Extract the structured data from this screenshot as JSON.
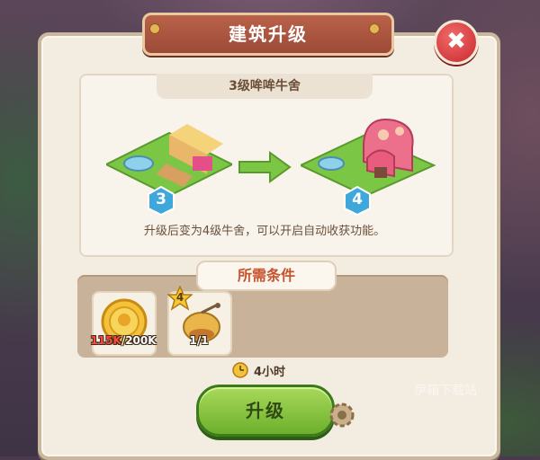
{
  "dialog": {
    "title": "建筑升级",
    "close_icon_glyph": "✖"
  },
  "preview": {
    "building_name": "3级哞哞牛舍",
    "current_level": "3",
    "next_level": "4",
    "description": "升级后变为4级牛舍，可以开启自动收获功能。"
  },
  "requirements": {
    "label": "所需条件",
    "items": [
      {
        "name": "gold-coin",
        "current": "115K",
        "required": "/200K",
        "shortfall": true
      },
      {
        "name": "bee-building",
        "level_star": "4",
        "current": "1",
        "required": "/1",
        "shortfall": false
      }
    ]
  },
  "upgrade": {
    "time": "4小时",
    "button_label": "升级"
  },
  "watermark": "伊箱下载站",
  "colors": {
    "accent_ribbon": "#b9624a",
    "button_green": "#6cb02c",
    "close_red": "#c9282c",
    "badge_blue": "#3fa7d9"
  }
}
